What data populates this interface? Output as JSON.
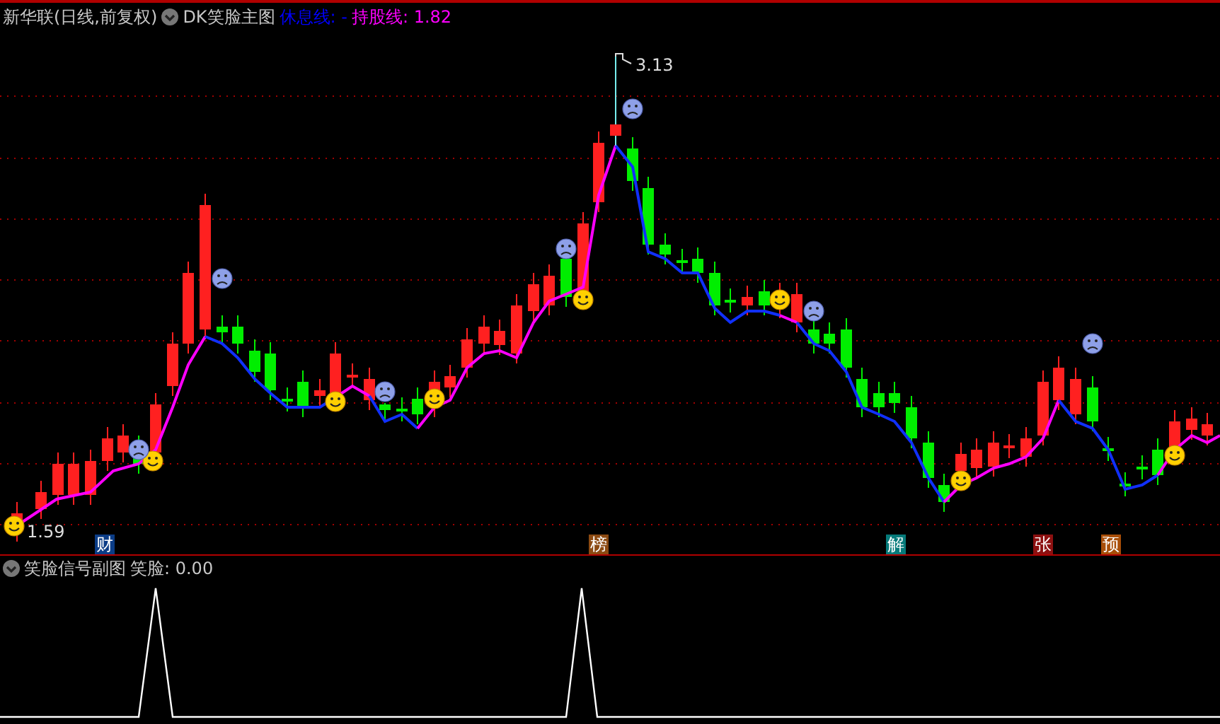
{
  "header": {
    "title": "新华联(日线,前复权)",
    "indicator": "DK笑脸主图",
    "legend": [
      {
        "label": "休息线: -",
        "color": "#0000ff"
      },
      {
        "label": "持股线: 1.82",
        "color": "#ff00ff"
      }
    ]
  },
  "main_chart": {
    "high_label": "3.13",
    "low_label": "1.59"
  },
  "event_tags": [
    {
      "label": "财",
      "color": "#0b3c86"
    },
    {
      "label": "榜",
      "color": "#8c4a12"
    },
    {
      "label": "解",
      "color": "#067a7a"
    },
    {
      "label": "张",
      "color": "#8c1010"
    },
    {
      "label": "预",
      "color": "#a84e08"
    }
  ],
  "sub_panel": {
    "title": "笑脸信号副图",
    "reading": "笑脸: 0.00"
  }
}
